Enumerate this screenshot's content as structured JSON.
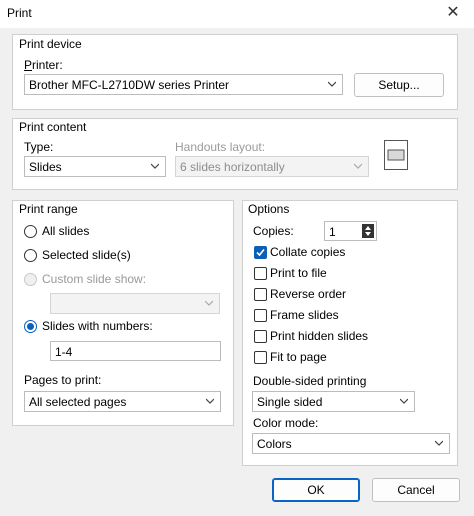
{
  "window": {
    "title": "Print",
    "close_glyph": "✕"
  },
  "print_device": {
    "section_label": "Print device",
    "printer_label": "Printer:",
    "printer_value": "Brother MFC-L2710DW series Printer",
    "setup_button": "Setup..."
  },
  "print_content": {
    "section_label": "Print content",
    "type_label": "Type:",
    "type_value": "Slides",
    "handouts_label": "Handouts layout:",
    "handouts_value": "6 slides horizontally"
  },
  "print_range": {
    "section_label": "Print range",
    "all_slides": "All slides",
    "selected_slides": "Selected slide(s)",
    "custom_show": "Custom slide show:",
    "custom_show_value": "",
    "slides_with_numbers": "Slides with numbers:",
    "slides_value": "1-4",
    "selected_option": "slides_with_numbers",
    "pages_label": "Pages to print:",
    "pages_value": "All selected pages"
  },
  "options": {
    "section_label": "Options",
    "copies_label": "Copies:",
    "copies_value": "1",
    "collate_copies": "Collate copies",
    "collate_checked": true,
    "print_to_file": "Print to file",
    "reverse_order": "Reverse order",
    "frame_slides": "Frame slides",
    "print_hidden_slides": "Print hidden slides",
    "fit_to_page": "Fit to page",
    "double_sided_label": "Double-sided printing",
    "double_sided_value": "Single sided",
    "color_mode_label": "Color mode:",
    "color_mode_value": "Colors"
  },
  "footer": {
    "ok_button": "OK",
    "cancel_button": "Cancel"
  },
  "colors": {
    "accent": "#0a5fb8",
    "panel": "#ffffff",
    "background": "#f0f0f0"
  }
}
